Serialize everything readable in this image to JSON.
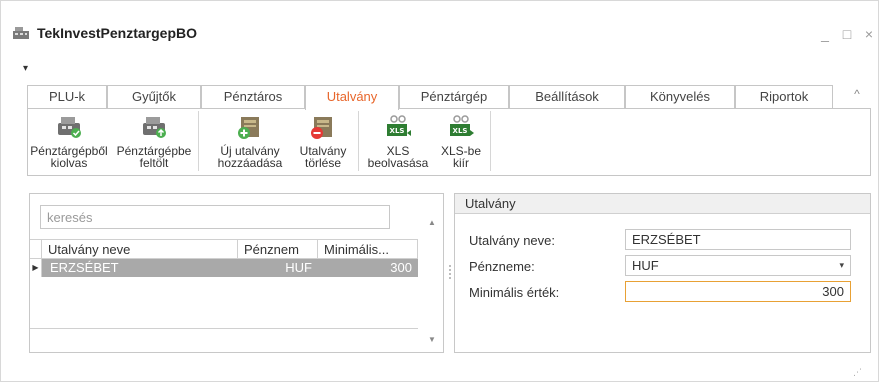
{
  "window": {
    "title": "TekInvestPenztargepBO",
    "min_glyph": "_",
    "max_glyph": "□",
    "close_glyph": "×",
    "qat_glyph": "▾"
  },
  "tabs": [
    {
      "label": "PLU-k"
    },
    {
      "label": "Gyűjtők"
    },
    {
      "label": "Pénztáros"
    },
    {
      "label": "Utalvány"
    },
    {
      "label": "Pénztárgép"
    },
    {
      "label": "Beállítások"
    },
    {
      "label": "Könyvelés"
    },
    {
      "label": "Riportok"
    }
  ],
  "active_tab": "Utalvány",
  "ribbon_collapse_glyph": "^",
  "ribbon": {
    "buttons": [
      {
        "line1": "Pénztárgépből",
        "line2": "kiolvas",
        "icon": "cash-register-read-icon"
      },
      {
        "line1": "Pénztárgépbe",
        "line2": "feltölt",
        "icon": "cash-register-upload-icon"
      },
      {
        "line1": "Új utalvány",
        "line2": "hozzáadása",
        "icon": "voucher-add-icon"
      },
      {
        "line1": "Utalvány",
        "line2": "törlése",
        "icon": "voucher-delete-icon"
      },
      {
        "line1": "XLS",
        "line2": "beolvasása",
        "icon": "xls-import-icon"
      },
      {
        "line1": "XLS-be",
        "line2": "kiír",
        "icon": "xls-export-icon"
      }
    ]
  },
  "list": {
    "search_placeholder": "keresés",
    "columns": [
      "Utalvány neve",
      "Pénznem",
      "Minimális..."
    ],
    "rows": [
      {
        "name": "ERZSÉBET",
        "currency": "HUF",
        "min": "300"
      }
    ],
    "row_indicator": "▶",
    "scroll_up": "▲",
    "scroll_down": "▼"
  },
  "detail": {
    "header": "Utalvány",
    "name_label": "Utalvány neve:",
    "name_value": "ERZSÉBET",
    "currency_label": "Pénzneme:",
    "currency_value": "HUF",
    "min_label": "Minimális érték:",
    "min_value": "300",
    "dropdown_glyph": "▾"
  },
  "colors": {
    "accent": "#e8662b",
    "selected_row": "#a9a9a9",
    "focus_border": "#e8a135"
  }
}
